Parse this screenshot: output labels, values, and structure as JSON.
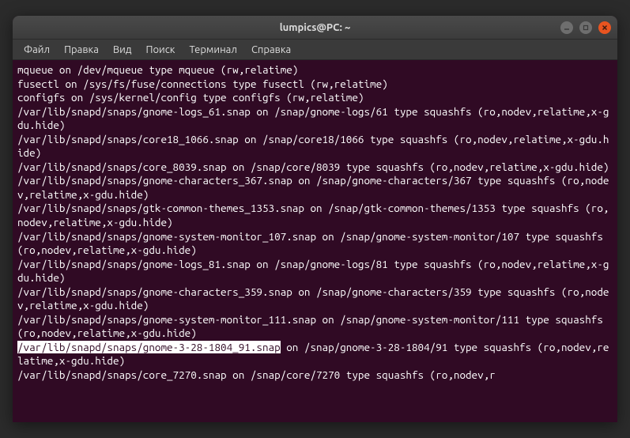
{
  "window": {
    "title": "lumpics@PC: ~"
  },
  "menu": {
    "file": "Файл",
    "edit": "Правка",
    "view": "Вид",
    "search": "Поиск",
    "terminal": "Терминал",
    "help": "Справка"
  },
  "terminal": {
    "lines": [
      "mqueue on /dev/mqueue type mqueue (rw,relatime)",
      "fusectl on /sys/fs/fuse/connections type fusectl (rw,relatime)",
      "configfs on /sys/kernel/config type configfs (rw,relatime)",
      "/var/lib/snapd/snaps/gnome-logs_61.snap on /snap/gnome-logs/61 type squashfs (ro,nodev,relatime,x-gdu.hide)",
      "/var/lib/snapd/snaps/core18_1066.snap on /snap/core18/1066 type squashfs (ro,nodev,relatime,x-gdu.hide)",
      "/var/lib/snapd/snaps/core_8039.snap on /snap/core/8039 type squashfs (ro,nodev,relatime,x-gdu.hide)",
      "/var/lib/snapd/snaps/gnome-characters_367.snap on /snap/gnome-characters/367 type squashfs (ro,nodev,relatime,x-gdu.hide)",
      "/var/lib/snapd/snaps/gtk-common-themes_1353.snap on /snap/gtk-common-themes/1353 type squashfs (ro,nodev,relatime,x-gdu.hide)",
      "/var/lib/snapd/snaps/gnome-system-monitor_107.snap on /snap/gnome-system-monitor/107 type squashfs (ro,nodev,relatime,x-gdu.hide)",
      "/var/lib/snapd/snaps/gnome-logs_81.snap on /snap/gnome-logs/81 type squashfs (ro,nodev,relatime,x-gdu.hide)",
      "/var/lib/snapd/snaps/gnome-characters_359.snap on /snap/gnome-characters/359 type squashfs (ro,nodev,relatime,x-gdu.hide)",
      "/var/lib/snapd/snaps/gnome-system-monitor_111.snap on /snap/gnome-system-monitor/111 type squashfs (ro,nodev,relatime,x-gdu.hide)"
    ],
    "highlighted_prefix": "/var/lib/snapd/snaps/gnome-3-28-1804_91.snap",
    "highlighted_suffix": " on /snap/gnome-3-28-1804/91 type squashfs (ro,nodev,relatime,x-gdu.hide)",
    "last_line": "/var/lib/snapd/snaps/core_7270.snap on /snap/core/7270 type squashfs (ro,nodev,r"
  }
}
